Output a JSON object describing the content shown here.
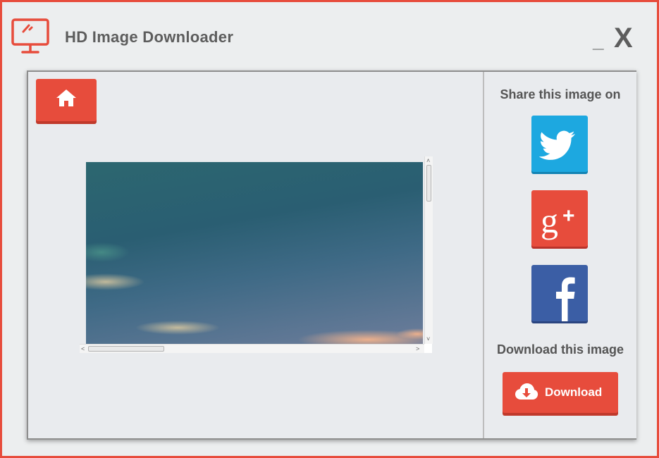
{
  "app": {
    "title": "HD Image Downloader",
    "minimize_label": "_",
    "close_label": "X"
  },
  "icons": {
    "app_logo": "monitor-icon",
    "home": "home-icon",
    "twitter": "twitter-icon",
    "google_plus": "google-plus-icon",
    "facebook": "facebook-icon",
    "download": "cloud-download-icon"
  },
  "sidebar": {
    "share_label": "Share this image on",
    "download_label": "Download this image",
    "download_button_label": "Download"
  },
  "colors": {
    "accent": "#e74c3c",
    "twitter": "#1da8e0",
    "google_plus": "#e74c3c",
    "facebook": "#3b5ea5",
    "text": "#555555"
  }
}
